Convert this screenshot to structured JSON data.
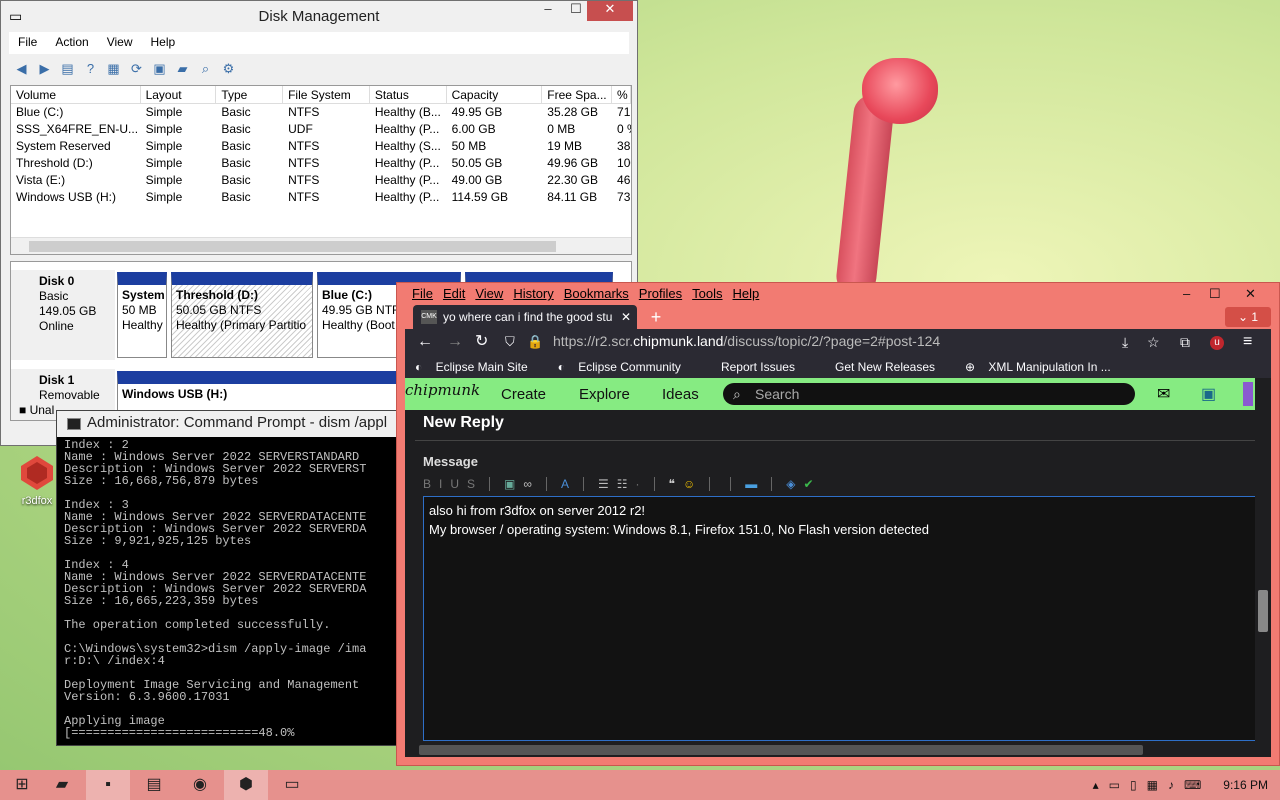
{
  "disk_mgmt": {
    "title": "Disk Management",
    "menu": [
      "File",
      "Action",
      "View",
      "Help"
    ],
    "columns": [
      "Volume",
      "Layout",
      "Type",
      "File System",
      "Status",
      "Capacity",
      "Free Spa...",
      "% F"
    ],
    "rows": [
      [
        "Blue (C:)",
        "Simple",
        "Basic",
        "NTFS",
        "Healthy (B...",
        "49.95 GB",
        "35.28 GB",
        "71"
      ],
      [
        "SSS_X64FRE_EN-U...",
        "Simple",
        "Basic",
        "UDF",
        "Healthy (P...",
        "6.00 GB",
        "0 MB",
        "0 %"
      ],
      [
        "System Reserved",
        "Simple",
        "Basic",
        "NTFS",
        "Healthy (S...",
        "50 MB",
        "19 MB",
        "38"
      ],
      [
        "Threshold (D:)",
        "Simple",
        "Basic",
        "NTFS",
        "Healthy (P...",
        "50.05 GB",
        "49.96 GB",
        "100"
      ],
      [
        "Vista (E:)",
        "Simple",
        "Basic",
        "NTFS",
        "Healthy (P...",
        "49.00 GB",
        "22.30 GB",
        "46"
      ],
      [
        "Windows USB (H:)",
        "Simple",
        "Basic",
        "NTFS",
        "Healthy (P...",
        "114.59 GB",
        "84.11 GB",
        "73"
      ]
    ],
    "disk0": {
      "name": "Disk 0",
      "type": "Basic",
      "size": "149.05 GB",
      "state": "Online"
    },
    "disk0_parts": [
      {
        "name": "System",
        "size": "50 MB",
        "status": "Healthy"
      },
      {
        "name": "Threshold  (D:)",
        "size": "50.05 GB NTFS",
        "status": "Healthy (Primary Partitio"
      },
      {
        "name": "Blue  (C:)",
        "size": "49.95 GB NTFS",
        "status": "Healthy (Boot"
      }
    ],
    "disk1": {
      "name": "Disk 1",
      "type": "Removable"
    },
    "disk1_part": "Windows USB  (H:)",
    "legend": "Unal"
  },
  "desktop_icon": {
    "label": "r3dfox"
  },
  "cmd": {
    "title": "Administrator: Command Prompt - dism  /appl",
    "lines": [
      "Index : 2",
      "Name : Windows Server 2022 SERVERSTANDARD",
      "Description : Windows Server 2022 SERVERST",
      "Size : 16,668,756,879 bytes",
      "",
      "Index : 3",
      "Name : Windows Server 2022 SERVERDATACENTE",
      "Description : Windows Server 2022 SERVERDA",
      "Size : 9,921,925,125 bytes",
      "",
      "Index : 4",
      "Name : Windows Server 2022 SERVERDATACENTE",
      "Description : Windows Server 2022 SERVERDA",
      "Size : 16,665,223,359 bytes",
      "",
      "The operation completed successfully.",
      "",
      "C:\\Windows\\system32>dism /apply-image /ima",
      "r:D:\\ /index:4",
      "",
      "Deployment Image Servicing and Management",
      "Version: 6.3.9600.17031",
      "",
      "Applying image",
      "[==========================48.0%"
    ]
  },
  "browser": {
    "menu": [
      "File",
      "Edit",
      "View",
      "History",
      "Bookmarks",
      "Profiles",
      "Tools",
      "Help"
    ],
    "tab_title": "yo where can i find the good stu",
    "tab_favicon": "CMK",
    "tab_count": "1",
    "url_prefix": "https://r2.scr.",
    "url_host": "chipmunk.land",
    "url_path": "/discuss/topic/2/?page=2#post-124",
    "bookmarks": [
      "Eclipse Main Site",
      "Eclipse Community",
      "Report Issues",
      "Get New Releases",
      "XML Manipulation In ..."
    ],
    "site": {
      "logo": "chipmunk",
      "nav": [
        "Create",
        "Explore",
        "Ideas"
      ],
      "search_placeholder": "Search",
      "heading": "New Reply",
      "message_label": "Message",
      "editor_lines": [
        "also hi from r3dfox on server 2012 r2!",
        "My browser / operating system: Windows 8.1, Firefox 151.0, No Flash version detected"
      ]
    },
    "accent_color": "#f27b72",
    "site_header_color": "#86eb82"
  },
  "taskbar": {
    "time": "9:16 PM"
  }
}
